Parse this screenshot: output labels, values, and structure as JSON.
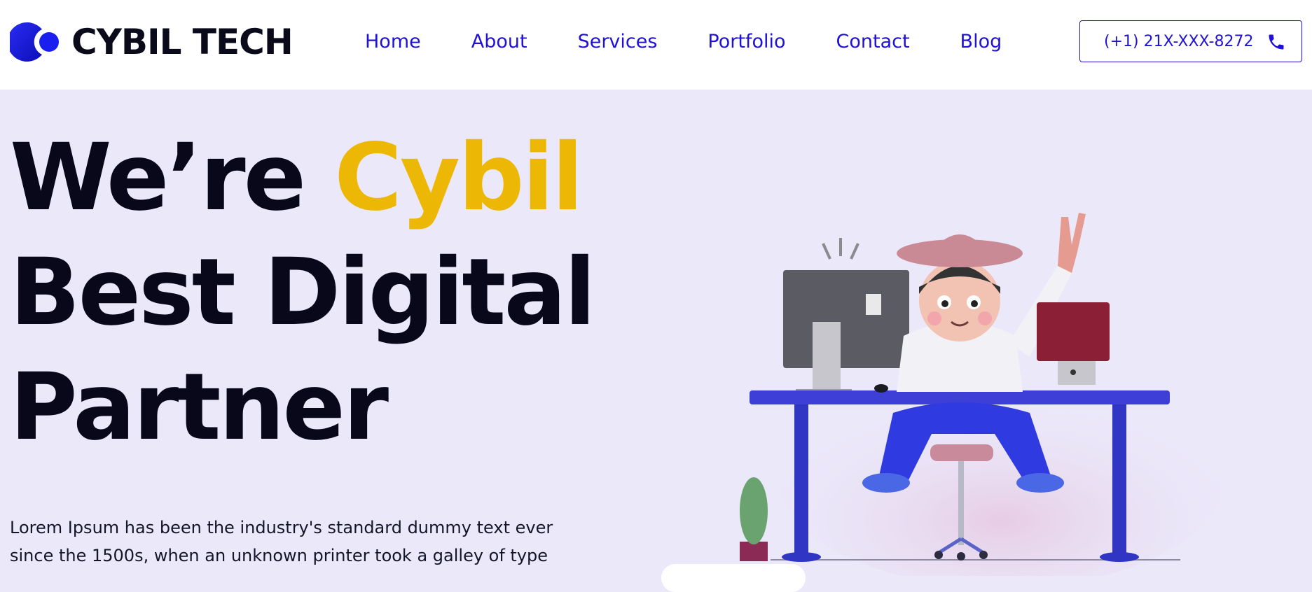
{
  "brand": {
    "name": "CYBIL TECH",
    "logo_color": "#1a1ff0"
  },
  "nav": {
    "items": [
      {
        "label": "Home"
      },
      {
        "label": "About"
      },
      {
        "label": "Services"
      },
      {
        "label": "Portfolio"
      },
      {
        "label": "Contact"
      },
      {
        "label": "Blog"
      }
    ]
  },
  "contact": {
    "phone": "(+1) 21X-XXX-8272",
    "icon": "phone-icon"
  },
  "hero": {
    "title_prefix": "We’re ",
    "title_highlight": "Cybil",
    "title_line2": "Best Digital",
    "title_line3": "Partner",
    "description": "Lorem Ipsum has been the industry's standard dummy text ever since the 1500s, when an unknown printer took a galley of type"
  },
  "colors": {
    "accent": "#ecb705",
    "primary": "#1f12d6",
    "hero_background": "#ebe8fa",
    "text": "#08081a"
  },
  "illustration": {
    "icon": "developer-at-desk-illustration"
  }
}
